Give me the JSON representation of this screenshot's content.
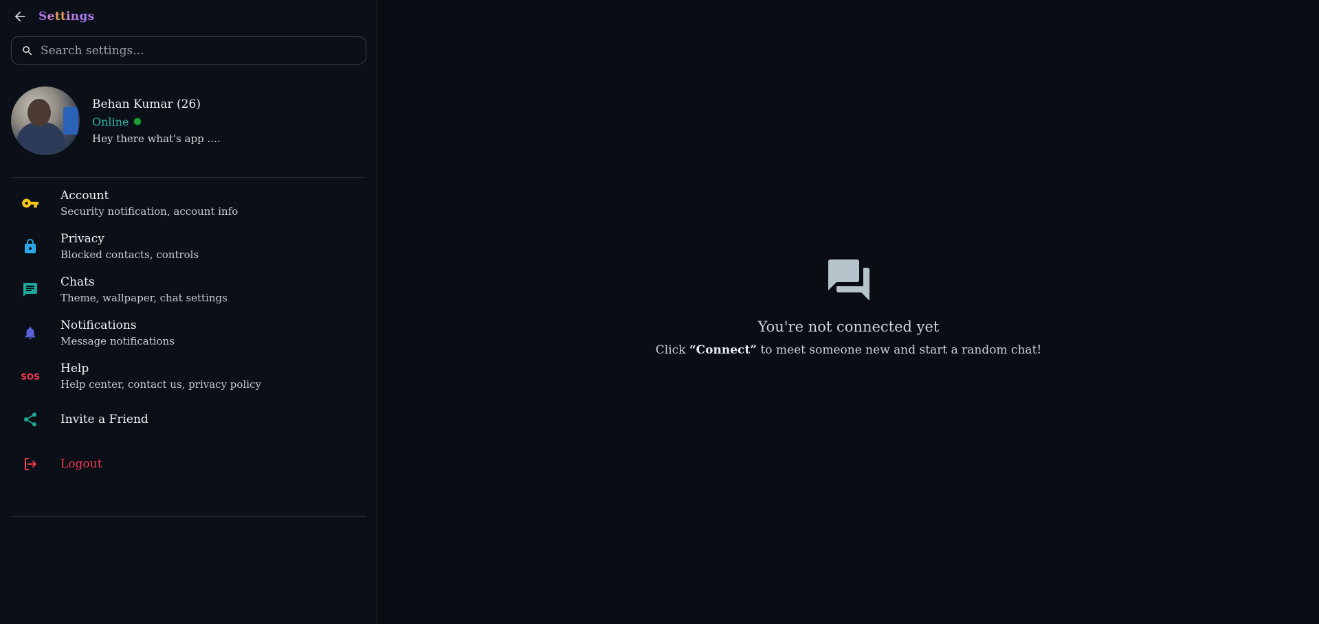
{
  "header": {
    "title_letters": [
      "S",
      "e",
      "t",
      "t",
      "i",
      "n",
      "g",
      "s"
    ],
    "back_icon": "arrow-left-icon"
  },
  "search": {
    "placeholder": "Search settings...",
    "value": ""
  },
  "profile": {
    "name": "Behan Kumar (26)",
    "status": "Online",
    "status_color": "#1f9e38",
    "about": "Hey there what's app ...."
  },
  "menu": {
    "items": [
      {
        "label": "Account",
        "desc": "Security notification, account info",
        "icon": "key-icon",
        "color": "#f5c518"
      },
      {
        "label": "Privacy",
        "desc": "Blocked contacts, controls",
        "icon": "lock-icon",
        "color": "#2aa7e8"
      },
      {
        "label": "Chats",
        "desc": "Theme, wallpaper, chat settings",
        "icon": "chat-icon",
        "color": "#1fa89a"
      },
      {
        "label": "Notifications",
        "desc": "Message notifications",
        "icon": "bell-icon",
        "color": "#5b61d9"
      },
      {
        "label": "Help",
        "desc": "Help center, contact us, privacy policy",
        "icon": "sos-icon",
        "color": "#f0384f"
      }
    ],
    "invite": {
      "label": "Invite a Friend",
      "icon": "share-icon",
      "color": "#1fa89a"
    },
    "logout": {
      "label": "Logout",
      "icon": "logout-icon",
      "color": "#f0384f"
    }
  },
  "main": {
    "empty_icon": "forum-icon",
    "empty_title": "You're not connected yet",
    "empty_sub_before": "Click ",
    "empty_sub_bold": "“Connect”",
    "empty_sub_after": " to meet someone new and start a random chat!"
  }
}
